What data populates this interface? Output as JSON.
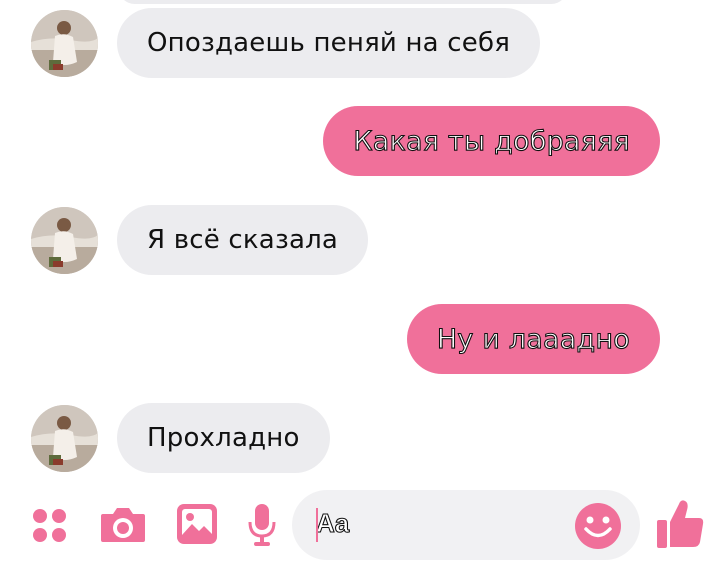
{
  "colors": {
    "accent": "#f0709a",
    "incoming_bubble": "#ececef",
    "input_background": "#f1f1f3"
  },
  "messages": [
    {
      "direction": "incoming",
      "text": "Опоздаешь пеняй на себя"
    },
    {
      "direction": "outgoing",
      "text": "Какая ты добраяяя"
    },
    {
      "direction": "incoming",
      "text": "Я всё сказала"
    },
    {
      "direction": "outgoing",
      "text": "Ну и лааадно"
    },
    {
      "direction": "incoming",
      "text": "Прохладно"
    }
  ],
  "composer": {
    "placeholder": "Aa",
    "icons": [
      "apps-icon",
      "camera-icon",
      "image-icon",
      "microphone-icon",
      "emoji-icon",
      "thumbs-up-icon"
    ]
  }
}
